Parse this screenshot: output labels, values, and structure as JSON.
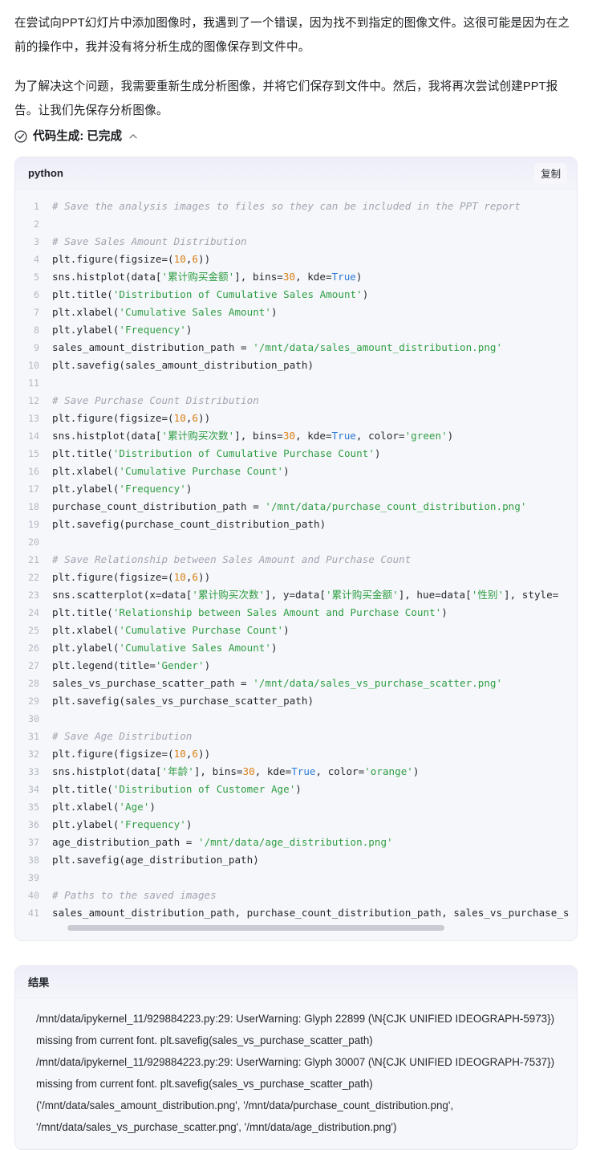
{
  "intro": {
    "paragraph_1": "在尝试向PPT幻灯片中添加图像时，我遇到了一个错误，因为找不到指定的图像文件。这很可能是因为在之前的操作中，我并没有将分析生成的图像保存到文件中。",
    "paragraph_2": "为了解决这个问题，我需要重新生成分析图像，并将它们保存到文件中。然后，我将再次尝试创建PPT报告。让我们先保存分析图像。"
  },
  "status": {
    "icon": "check-circle-icon",
    "label": "代码生成: 已完成",
    "toggle_icon": "chevron-up-icon"
  },
  "code_block": {
    "language": "python",
    "copy_label": "复制",
    "scrollbar": "horizontal-scrollbar",
    "lines": [
      {
        "n": "1",
        "tokens": [
          {
            "t": "# Save the analysis images to files so they can be included in the PPT report",
            "c": "cm"
          }
        ]
      },
      {
        "n": "2",
        "tokens": []
      },
      {
        "n": "3",
        "tokens": [
          {
            "t": "# Save Sales Amount Distribution",
            "c": "cm"
          }
        ]
      },
      {
        "n": "4",
        "tokens": [
          {
            "t": "plt.figure(figsize=(",
            "c": ""
          },
          {
            "t": "10",
            "c": "nu"
          },
          {
            "t": ",",
            "c": ""
          },
          {
            "t": "6",
            "c": "nu"
          },
          {
            "t": "))",
            "c": ""
          }
        ]
      },
      {
        "n": "5",
        "tokens": [
          {
            "t": "sns.histplot(data[",
            "c": ""
          },
          {
            "t": "'累计购买金额'",
            "c": "st"
          },
          {
            "t": "], bins=",
            "c": ""
          },
          {
            "t": "30",
            "c": "nu"
          },
          {
            "t": ", kde=",
            "c": ""
          },
          {
            "t": "True",
            "c": "kw"
          },
          {
            "t": ")",
            "c": ""
          }
        ]
      },
      {
        "n": "6",
        "tokens": [
          {
            "t": "plt.title(",
            "c": ""
          },
          {
            "t": "'Distribution of Cumulative Sales Amount'",
            "c": "st"
          },
          {
            "t": ")",
            "c": ""
          }
        ]
      },
      {
        "n": "7",
        "tokens": [
          {
            "t": "plt.xlabel(",
            "c": ""
          },
          {
            "t": "'Cumulative Sales Amount'",
            "c": "st"
          },
          {
            "t": ")",
            "c": ""
          }
        ]
      },
      {
        "n": "8",
        "tokens": [
          {
            "t": "plt.ylabel(",
            "c": ""
          },
          {
            "t": "'Frequency'",
            "c": "st"
          },
          {
            "t": ")",
            "c": ""
          }
        ]
      },
      {
        "n": "9",
        "tokens": [
          {
            "t": "sales_amount_distribution_path = ",
            "c": ""
          },
          {
            "t": "'/mnt/data/sales_amount_distribution.png'",
            "c": "st"
          }
        ]
      },
      {
        "n": "10",
        "tokens": [
          {
            "t": "plt.savefig(sales_amount_distribution_path)",
            "c": ""
          }
        ]
      },
      {
        "n": "11",
        "tokens": []
      },
      {
        "n": "12",
        "tokens": [
          {
            "t": "# Save Purchase Count Distribution",
            "c": "cm"
          }
        ]
      },
      {
        "n": "13",
        "tokens": [
          {
            "t": "plt.figure(figsize=(",
            "c": ""
          },
          {
            "t": "10",
            "c": "nu"
          },
          {
            "t": ",",
            "c": ""
          },
          {
            "t": "6",
            "c": "nu"
          },
          {
            "t": "))",
            "c": ""
          }
        ]
      },
      {
        "n": "14",
        "tokens": [
          {
            "t": "sns.histplot(data[",
            "c": ""
          },
          {
            "t": "'累计购买次数'",
            "c": "st"
          },
          {
            "t": "], bins=",
            "c": ""
          },
          {
            "t": "30",
            "c": "nu"
          },
          {
            "t": ", kde=",
            "c": ""
          },
          {
            "t": "True",
            "c": "kw"
          },
          {
            "t": ", color=",
            "c": ""
          },
          {
            "t": "'green'",
            "c": "st"
          },
          {
            "t": ")",
            "c": ""
          }
        ]
      },
      {
        "n": "15",
        "tokens": [
          {
            "t": "plt.title(",
            "c": ""
          },
          {
            "t": "'Distribution of Cumulative Purchase Count'",
            "c": "st"
          },
          {
            "t": ")",
            "c": ""
          }
        ]
      },
      {
        "n": "16",
        "tokens": [
          {
            "t": "plt.xlabel(",
            "c": ""
          },
          {
            "t": "'Cumulative Purchase Count'",
            "c": "st"
          },
          {
            "t": ")",
            "c": ""
          }
        ]
      },
      {
        "n": "17",
        "tokens": [
          {
            "t": "plt.ylabel(",
            "c": ""
          },
          {
            "t": "'Frequency'",
            "c": "st"
          },
          {
            "t": ")",
            "c": ""
          }
        ]
      },
      {
        "n": "18",
        "tokens": [
          {
            "t": "purchase_count_distribution_path = ",
            "c": ""
          },
          {
            "t": "'/mnt/data/purchase_count_distribution.png'",
            "c": "st"
          }
        ]
      },
      {
        "n": "19",
        "tokens": [
          {
            "t": "plt.savefig(purchase_count_distribution_path)",
            "c": ""
          }
        ]
      },
      {
        "n": "20",
        "tokens": []
      },
      {
        "n": "21",
        "tokens": [
          {
            "t": "# Save Relationship between Sales Amount and Purchase Count",
            "c": "cm"
          }
        ]
      },
      {
        "n": "22",
        "tokens": [
          {
            "t": "plt.figure(figsize=(",
            "c": ""
          },
          {
            "t": "10",
            "c": "nu"
          },
          {
            "t": ",",
            "c": ""
          },
          {
            "t": "6",
            "c": "nu"
          },
          {
            "t": "))",
            "c": ""
          }
        ]
      },
      {
        "n": "23",
        "tokens": [
          {
            "t": "sns.scatterplot(x=data[",
            "c": ""
          },
          {
            "t": "'累计购买次数'",
            "c": "st"
          },
          {
            "t": "], y=data[",
            "c": ""
          },
          {
            "t": "'累计购买金额'",
            "c": "st"
          },
          {
            "t": "], hue=data[",
            "c": ""
          },
          {
            "t": "'性别'",
            "c": "st"
          },
          {
            "t": "], style=",
            "c": ""
          }
        ]
      },
      {
        "n": "24",
        "tokens": [
          {
            "t": "plt.title(",
            "c": ""
          },
          {
            "t": "'Relationship between Sales Amount and Purchase Count'",
            "c": "st"
          },
          {
            "t": ")",
            "c": ""
          }
        ]
      },
      {
        "n": "25",
        "tokens": [
          {
            "t": "plt.xlabel(",
            "c": ""
          },
          {
            "t": "'Cumulative Purchase Count'",
            "c": "st"
          },
          {
            "t": ")",
            "c": ""
          }
        ]
      },
      {
        "n": "26",
        "tokens": [
          {
            "t": "plt.ylabel(",
            "c": ""
          },
          {
            "t": "'Cumulative Sales Amount'",
            "c": "st"
          },
          {
            "t": ")",
            "c": ""
          }
        ]
      },
      {
        "n": "27",
        "tokens": [
          {
            "t": "plt.legend(title=",
            "c": ""
          },
          {
            "t": "'Gender'",
            "c": "st"
          },
          {
            "t": ")",
            "c": ""
          }
        ]
      },
      {
        "n": "28",
        "tokens": [
          {
            "t": "sales_vs_purchase_scatter_path = ",
            "c": ""
          },
          {
            "t": "'/mnt/data/sales_vs_purchase_scatter.png'",
            "c": "st"
          }
        ]
      },
      {
        "n": "29",
        "tokens": [
          {
            "t": "plt.savefig(sales_vs_purchase_scatter_path)",
            "c": ""
          }
        ]
      },
      {
        "n": "30",
        "tokens": []
      },
      {
        "n": "31",
        "tokens": [
          {
            "t": "# Save Age Distribution",
            "c": "cm"
          }
        ]
      },
      {
        "n": "32",
        "tokens": [
          {
            "t": "plt.figure(figsize=(",
            "c": ""
          },
          {
            "t": "10",
            "c": "nu"
          },
          {
            "t": ",",
            "c": ""
          },
          {
            "t": "6",
            "c": "nu"
          },
          {
            "t": "))",
            "c": ""
          }
        ]
      },
      {
        "n": "33",
        "tokens": [
          {
            "t": "sns.histplot(data[",
            "c": ""
          },
          {
            "t": "'年龄'",
            "c": "st"
          },
          {
            "t": "], bins=",
            "c": ""
          },
          {
            "t": "30",
            "c": "nu"
          },
          {
            "t": ", kde=",
            "c": ""
          },
          {
            "t": "True",
            "c": "kw"
          },
          {
            "t": ", color=",
            "c": ""
          },
          {
            "t": "'orange'",
            "c": "st"
          },
          {
            "t": ")",
            "c": ""
          }
        ]
      },
      {
        "n": "34",
        "tokens": [
          {
            "t": "plt.title(",
            "c": ""
          },
          {
            "t": "'Distribution of Customer Age'",
            "c": "st"
          },
          {
            "t": ")",
            "c": ""
          }
        ]
      },
      {
        "n": "35",
        "tokens": [
          {
            "t": "plt.xlabel(",
            "c": ""
          },
          {
            "t": "'Age'",
            "c": "st"
          },
          {
            "t": ")",
            "c": ""
          }
        ]
      },
      {
        "n": "36",
        "tokens": [
          {
            "t": "plt.ylabel(",
            "c": ""
          },
          {
            "t": "'Frequency'",
            "c": "st"
          },
          {
            "t": ")",
            "c": ""
          }
        ]
      },
      {
        "n": "37",
        "tokens": [
          {
            "t": "age_distribution_path = ",
            "c": ""
          },
          {
            "t": "'/mnt/data/age_distribution.png'",
            "c": "st"
          }
        ]
      },
      {
        "n": "38",
        "tokens": [
          {
            "t": "plt.savefig(age_distribution_path)",
            "c": ""
          }
        ]
      },
      {
        "n": "39",
        "tokens": []
      },
      {
        "n": "40",
        "tokens": [
          {
            "t": "# Paths to the saved images",
            "c": "cm"
          }
        ]
      },
      {
        "n": "41",
        "tokens": [
          {
            "t": "sales_amount_distribution_path, purchase_count_distribution_path, sales_vs_purchase_s",
            "c": ""
          }
        ]
      }
    ]
  },
  "result_block": {
    "title": "结果",
    "output_lines": [
      "/mnt/data/ipykernel_11/929884223.py:29: UserWarning: Glyph 22899 (\\N{CJK UNIFIED IDEOGRAPH-5973}) missing from current font. plt.savefig(sales_vs_purchase_scatter_path)",
      "/mnt/data/ipykernel_11/929884223.py:29: UserWarning: Glyph 30007 (\\N{CJK UNIFIED IDEOGRAPH-7537}) missing from current font. plt.savefig(sales_vs_purchase_scatter_path)",
      "('/mnt/data/sales_amount_distribution.png', '/mnt/data/purchase_count_distribution.png', '/mnt/data/sales_vs_purchase_scatter.png', '/mnt/data/age_distribution.png')"
    ]
  },
  "colors": {
    "string": "#2f9e44",
    "number": "#d98018",
    "keyword": "#2f7bd6",
    "comment": "#a0a5b0",
    "text": "#24292f",
    "card_bg": "#f6f7fa",
    "header_bg": "#eeeefb"
  }
}
